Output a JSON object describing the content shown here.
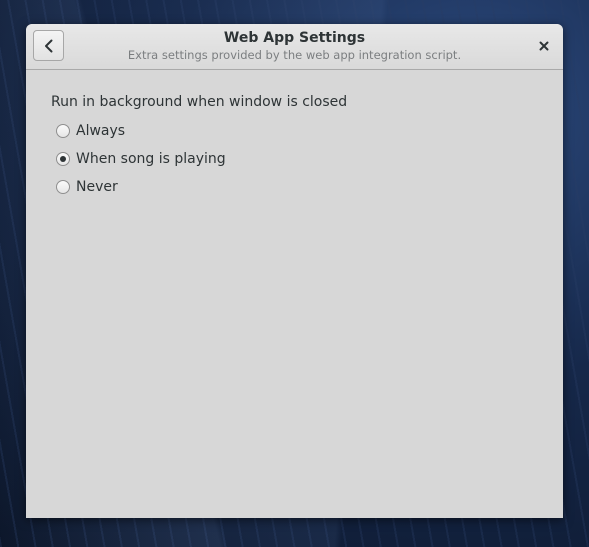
{
  "dialog": {
    "title": "Web App Settings",
    "subtitle": "Extra settings provided by the web app integration script.",
    "back_icon": "chevron-left-icon",
    "close_icon": "close-icon"
  },
  "background_setting": {
    "label": "Run in background when window is closed",
    "options": [
      {
        "label": "Always",
        "selected": false
      },
      {
        "label": "When song is playing",
        "selected": true
      },
      {
        "label": "Never",
        "selected": false
      }
    ]
  },
  "colors": {
    "window_bg": "#d7d7d7",
    "text": "#2e3436",
    "subtitle": "#7b7e80"
  }
}
